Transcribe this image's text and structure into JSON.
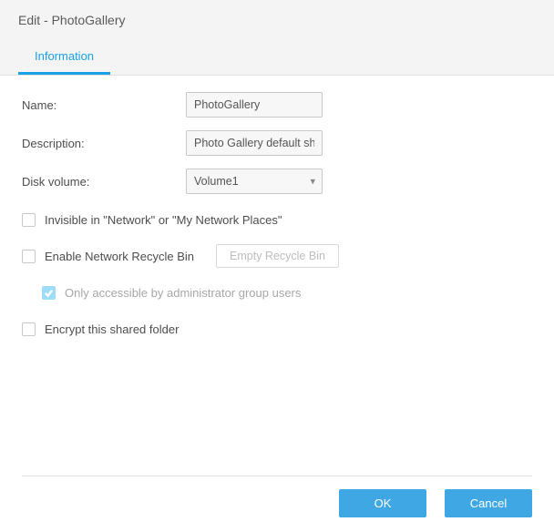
{
  "dialog": {
    "title": "Edit - PhotoGallery"
  },
  "tabs": {
    "information": "Information"
  },
  "form": {
    "name_label": "Name:",
    "name_value": "PhotoGallery",
    "description_label": "Description:",
    "description_value": "Photo Gallery default sh",
    "disk_label": "Disk volume:",
    "disk_value": "Volume1"
  },
  "checks": {
    "invisible": "Invisible in \"Network\" or \"My Network Places\"",
    "recycle": "Enable Network Recycle Bin",
    "empty_btn": "Empty Recycle Bin",
    "admin_only": "Only accessible by administrator group users",
    "encrypt": "Encrypt this shared folder"
  },
  "footer": {
    "ok": "OK",
    "cancel": "Cancel"
  }
}
